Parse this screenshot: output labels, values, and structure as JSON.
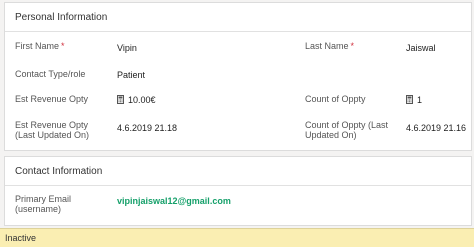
{
  "personal": {
    "title": "Personal Information",
    "first_name_label": "First Name",
    "first_name_value": "Vipin",
    "last_name_label": "Last Name",
    "last_name_value": "Jaiswal",
    "required_marker": "*",
    "contact_type_label": "Contact Type/role",
    "contact_type_value": "Patient",
    "est_revenue_label": "Est Revenue Opty",
    "est_revenue_value": "10.00€",
    "count_oppty_label": "Count of Oppty",
    "count_oppty_value": "1",
    "est_revenue_updated_label_1": "Est Revenue Opty",
    "est_revenue_updated_label_2": "(Last Updated On)",
    "est_revenue_updated_value": "4.6.2019  21.18",
    "count_updated_label_1": "Count of Oppty (Last",
    "count_updated_label_2": "Updated On)",
    "count_updated_value": "4.6.2019  21.16"
  },
  "contact": {
    "title": "Contact Information",
    "email_label_1": "Primary Email",
    "email_label_2": "(username)",
    "email_value": "vipinjaiswal12@gmail.com"
  },
  "status": {
    "text": "Inactive"
  }
}
